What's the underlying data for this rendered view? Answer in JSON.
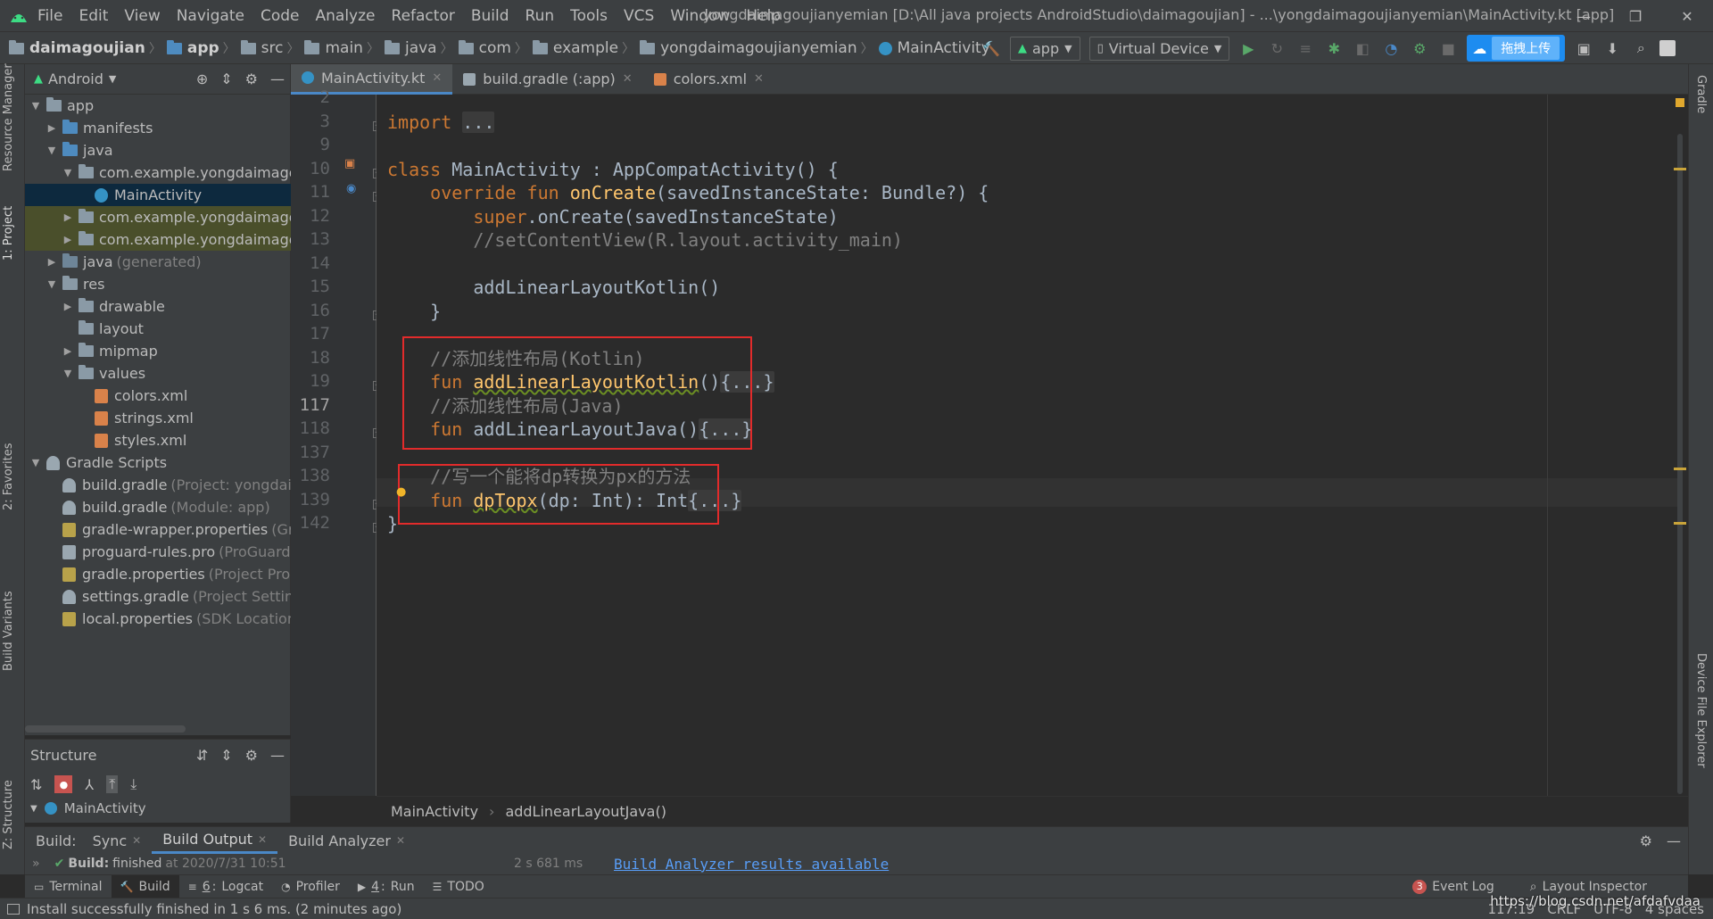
{
  "menu": [
    "File",
    "Edit",
    "View",
    "Navigate",
    "Code",
    "Analyze",
    "Refactor",
    "Build",
    "Run",
    "Tools",
    "VCS",
    "Window",
    "Help"
  ],
  "window_title": "yongdaimagoujianyemian [D:\\All java projects AndroidStudio\\daimagoujian] - ...\\yongdaimagoujianyemian\\MainActivity.kt [app]",
  "breadcrumb": [
    "daimagoujian",
    "app",
    "src",
    "main",
    "java",
    "com",
    "example",
    "yongdaimagoujianyemian",
    "MainActivity"
  ],
  "toolbar": {
    "run_config": "app",
    "device": "Virtual Device",
    "upload_label": "拖拽上传"
  },
  "left_stripe": [
    "Resource Manager",
    "1: Project",
    "2: Favorites",
    "Build Variants",
    "Z: Structure"
  ],
  "right_stripe": [
    "Gradle",
    "Device File Explorer"
  ],
  "project": {
    "view_label": "Android",
    "tree": [
      {
        "label": "app",
        "muted": "",
        "depth": 0,
        "arrow": "▼",
        "icon": "folder-module",
        "state": ""
      },
      {
        "label": "manifests",
        "muted": "",
        "depth": 1,
        "arrow": "▶",
        "icon": "folder-blue",
        "state": ""
      },
      {
        "label": "java",
        "muted": "",
        "depth": 1,
        "arrow": "▼",
        "icon": "folder-blue",
        "state": ""
      },
      {
        "label": "com.example.yongdaimagoujianyemian",
        "muted": "",
        "depth": 2,
        "arrow": "▼",
        "icon": "package",
        "state": ""
      },
      {
        "label": "MainActivity",
        "muted": "",
        "depth": 3,
        "arrow": "",
        "icon": "kotlin-class",
        "state": "sel"
      },
      {
        "label": "com.example.yongdaimagoujianyemian",
        "muted": "",
        "depth": 2,
        "arrow": "▶",
        "icon": "package",
        "state": "hl"
      },
      {
        "label": "com.example.yongdaimagoujianyemian",
        "muted": "",
        "depth": 2,
        "arrow": "▶",
        "icon": "package",
        "state": "hl"
      },
      {
        "label": "java",
        "muted": "(generated)",
        "depth": 1,
        "arrow": "▶",
        "icon": "folder-gen",
        "state": ""
      },
      {
        "label": "res",
        "muted": "",
        "depth": 1,
        "arrow": "▼",
        "icon": "folder-res",
        "state": ""
      },
      {
        "label": "drawable",
        "muted": "",
        "depth": 2,
        "arrow": "▶",
        "icon": "folder",
        "state": ""
      },
      {
        "label": "layout",
        "muted": "",
        "depth": 2,
        "arrow": "",
        "icon": "folder",
        "state": ""
      },
      {
        "label": "mipmap",
        "muted": "",
        "depth": 2,
        "arrow": "▶",
        "icon": "folder",
        "state": ""
      },
      {
        "label": "values",
        "muted": "",
        "depth": 2,
        "arrow": "▼",
        "icon": "folder",
        "state": ""
      },
      {
        "label": "colors.xml",
        "muted": "",
        "depth": 3,
        "arrow": "",
        "icon": "xml",
        "state": ""
      },
      {
        "label": "strings.xml",
        "muted": "",
        "depth": 3,
        "arrow": "",
        "icon": "xml",
        "state": ""
      },
      {
        "label": "styles.xml",
        "muted": "",
        "depth": 3,
        "arrow": "",
        "icon": "xml",
        "state": ""
      },
      {
        "label": "Gradle Scripts",
        "muted": "",
        "depth": 0,
        "arrow": "▼",
        "icon": "gradle",
        "state": ""
      },
      {
        "label": "build.gradle",
        "muted": "(Project: yongdaimagoujianyemian)",
        "depth": 1,
        "arrow": "",
        "icon": "gradle",
        "state": ""
      },
      {
        "label": "build.gradle",
        "muted": "(Module: app)",
        "depth": 1,
        "arrow": "",
        "icon": "gradle",
        "state": ""
      },
      {
        "label": "gradle-wrapper.properties",
        "muted": "(Gradle Version)",
        "depth": 1,
        "arrow": "",
        "icon": "props",
        "state": ""
      },
      {
        "label": "proguard-rules.pro",
        "muted": "(ProGuard Rules for app)",
        "depth": 1,
        "arrow": "",
        "icon": "file",
        "state": ""
      },
      {
        "label": "gradle.properties",
        "muted": "(Project Properties)",
        "depth": 1,
        "arrow": "",
        "icon": "props",
        "state": ""
      },
      {
        "label": "settings.gradle",
        "muted": "(Project Settings)",
        "depth": 1,
        "arrow": "",
        "icon": "gradle",
        "state": ""
      },
      {
        "label": "local.properties",
        "muted": "(SDK Location)",
        "depth": 1,
        "arrow": "",
        "icon": "props",
        "state": ""
      }
    ]
  },
  "structure": {
    "title": "Structure",
    "root": "MainActivity"
  },
  "editor_tabs": [
    {
      "label": "MainActivity.kt",
      "active": true
    },
    {
      "label": "build.gradle (:app)",
      "active": false
    },
    {
      "label": "colors.xml",
      "active": false
    }
  ],
  "code_lines": [
    {
      "ln": "2",
      "html": ""
    },
    {
      "ln": "3",
      "html": "<span class='kw'>import</span> <span class='fold-ph'>...</span>"
    },
    {
      "ln": "9",
      "html": ""
    },
    {
      "ln": "10",
      "html": "<span class='kw'>class</span> MainActivity : AppCompatActivity() {"
    },
    {
      "ln": "11",
      "html": "    <span class='kw'>override fun</span> <span class='fn'>onCreate</span>(savedInstanceState: Bundle?) {"
    },
    {
      "ln": "12",
      "html": "        <span class='kw'>super</span>.onCreate(savedInstanceState)"
    },
    {
      "ln": "13",
      "html": "        <span class='cm'>//setContentView(R.layout.activity_main)</span>"
    },
    {
      "ln": "14",
      "html": ""
    },
    {
      "ln": "15",
      "html": "        addLinearLayoutKotlin()"
    },
    {
      "ln": "16",
      "html": "    }"
    },
    {
      "ln": "17",
      "html": ""
    },
    {
      "ln": "18",
      "html": "    <span class='cm'>//添加线性布局(Kotlin)</span>"
    },
    {
      "ln": "19",
      "html": "    <span class='kw'>fun</span> <span class='fn und'>addLinearLayoutKotlin</span>()<span class='fold-ph'>{...}</span>"
    },
    {
      "ln": "117",
      "html": "    <span class='cm'>//添加线性布局(Java)</span>"
    },
    {
      "ln": "118",
      "html": "    <span class='kw'>fun</span> addLinearLayoutJava()<span class='fold-ph'>{...}</span>"
    },
    {
      "ln": "137",
      "html": ""
    },
    {
      "ln": "138",
      "html": "    <span class='cm'>//写一个能将dp转换为px的方法</span>"
    },
    {
      "ln": "139",
      "html": "    <span class='kw'>fun</span> <span class='fn und'>dpTopx</span>(dp: Int): Int<span class='fold-ph'>{...}</span>"
    },
    {
      "ln": "142",
      "html": "}"
    }
  ],
  "editor_breadcrumb": [
    "MainActivity",
    "addLinearLayoutJava()"
  ],
  "build": {
    "label": "Build:",
    "tabs": [
      "Sync",
      "Build Output",
      "Build Analyzer"
    ],
    "status": "finished",
    "status_time": "at 2020/7/31 10:51",
    "duration": "2 s 681 ms",
    "analyzer_msg": "Build Analyzer results available"
  },
  "bottom_tabs": [
    {
      "num": "",
      "label": "Terminal",
      "icon": "terminal-icon"
    },
    {
      "num": "",
      "label": "Build",
      "icon": "hammer-icon"
    },
    {
      "num": "6",
      "label": "Logcat",
      "icon": "logcat-icon"
    },
    {
      "num": "",
      "label": "Profiler",
      "icon": "profiler-icon"
    },
    {
      "num": "4",
      "label": "Run",
      "icon": "run-icon"
    },
    {
      "num": "",
      "label": "TODO",
      "icon": "todo-icon"
    }
  ],
  "bottom_right": {
    "event_log_count": "3",
    "event_log": "Event Log",
    "layout_inspector": "Layout Inspector"
  },
  "status": {
    "message": "Install successfully finished in 1 s 6 ms. (2 minutes ago)",
    "position": "117:19",
    "line_sep": "CRLF",
    "encoding": "UTF-8",
    "indent": "4 spaces",
    "watermark": "https://blog.csdn.net/afdafvdaa"
  },
  "colors": {
    "keyword": "#cc7832",
    "function": "#ffc66d",
    "comment": "#808080",
    "annotation_box": "#e22b2b",
    "selection": "#0d293e"
  }
}
